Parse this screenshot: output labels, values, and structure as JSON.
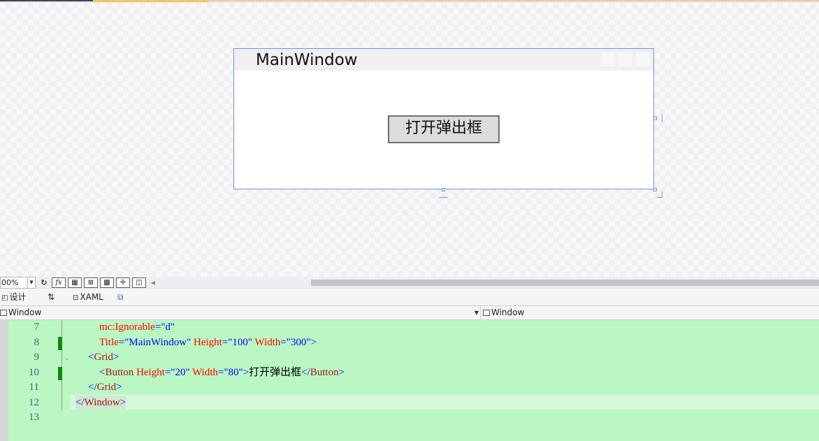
{
  "designer": {
    "window_title": "MainWindow",
    "button_label": "打开弹出框"
  },
  "toolbar": {
    "zoom_value": "00%",
    "icons": [
      "refresh-icon",
      "fx-icon",
      "grid-icon",
      "snap-grid-icon",
      "artboard-icon",
      "snap-lines-icon",
      "device-icon"
    ]
  },
  "tabs": {
    "design_label": "设计",
    "swap_label": "⇅",
    "xaml_label": "XAML"
  },
  "nav": {
    "left_scope": "Window",
    "right_scope": "Window"
  },
  "editor": {
    "lines": [
      {
        "num": "7",
        "tokens": [
          {
            "t": "attr",
            "v": "mc"
          },
          {
            "t": "attr",
            "v": ":Ignorable"
          },
          {
            "t": "punc",
            "v": "="
          },
          {
            "t": "val",
            "v": "\"d\""
          }
        ]
      },
      {
        "num": "8",
        "tokens": [
          {
            "t": "attr",
            "v": "Title"
          },
          {
            "t": "punc",
            "v": "="
          },
          {
            "t": "val",
            "v": "\"MainWindow\""
          },
          {
            "t": "attr",
            "v": " Height"
          },
          {
            "t": "punc",
            "v": "="
          },
          {
            "t": "val",
            "v": "\"100\""
          },
          {
            "t": "attr",
            "v": " Width"
          },
          {
            "t": "punc",
            "v": "="
          },
          {
            "t": "val",
            "v": "\"300\""
          },
          {
            "t": "punc",
            "v": ">"
          }
        ]
      },
      {
        "num": "9",
        "tokens": [
          {
            "t": "punc",
            "v": "<"
          },
          {
            "t": "tag",
            "v": "Grid"
          },
          {
            "t": "punc",
            "v": ">"
          }
        ]
      },
      {
        "num": "10",
        "tokens": [
          {
            "t": "punc",
            "v": "<"
          },
          {
            "t": "tag",
            "v": "Button"
          },
          {
            "t": "attr",
            "v": " Height"
          },
          {
            "t": "punc",
            "v": "="
          },
          {
            "t": "val",
            "v": "\"20\""
          },
          {
            "t": "attr",
            "v": " Width"
          },
          {
            "t": "punc",
            "v": "="
          },
          {
            "t": "val",
            "v": "\"80\""
          },
          {
            "t": "punc",
            "v": ">"
          },
          {
            "t": "txt",
            "v": "打开弹出框"
          },
          {
            "t": "punc",
            "v": "</"
          },
          {
            "t": "tag",
            "v": "Button"
          },
          {
            "t": "punc",
            "v": ">"
          }
        ]
      },
      {
        "num": "11",
        "tokens": [
          {
            "t": "punc",
            "v": "</"
          },
          {
            "t": "tag",
            "v": "Grid"
          },
          {
            "t": "punc",
            "v": ">"
          }
        ]
      },
      {
        "num": "12",
        "tokens": [
          {
            "t": "punc",
            "v": "</"
          },
          {
            "t": "tag",
            "v": "Window"
          },
          {
            "t": "punc",
            "v": ">"
          }
        ]
      },
      {
        "num": "13",
        "tokens": []
      }
    ]
  },
  "colors": {
    "editor_bg": "#bbf7c2",
    "change_mark": "#108a10",
    "selection_border": "#6f96d8",
    "xml_tag": "#a31515",
    "xml_attr": "#ff0000",
    "xml_value": "#0000ff"
  }
}
